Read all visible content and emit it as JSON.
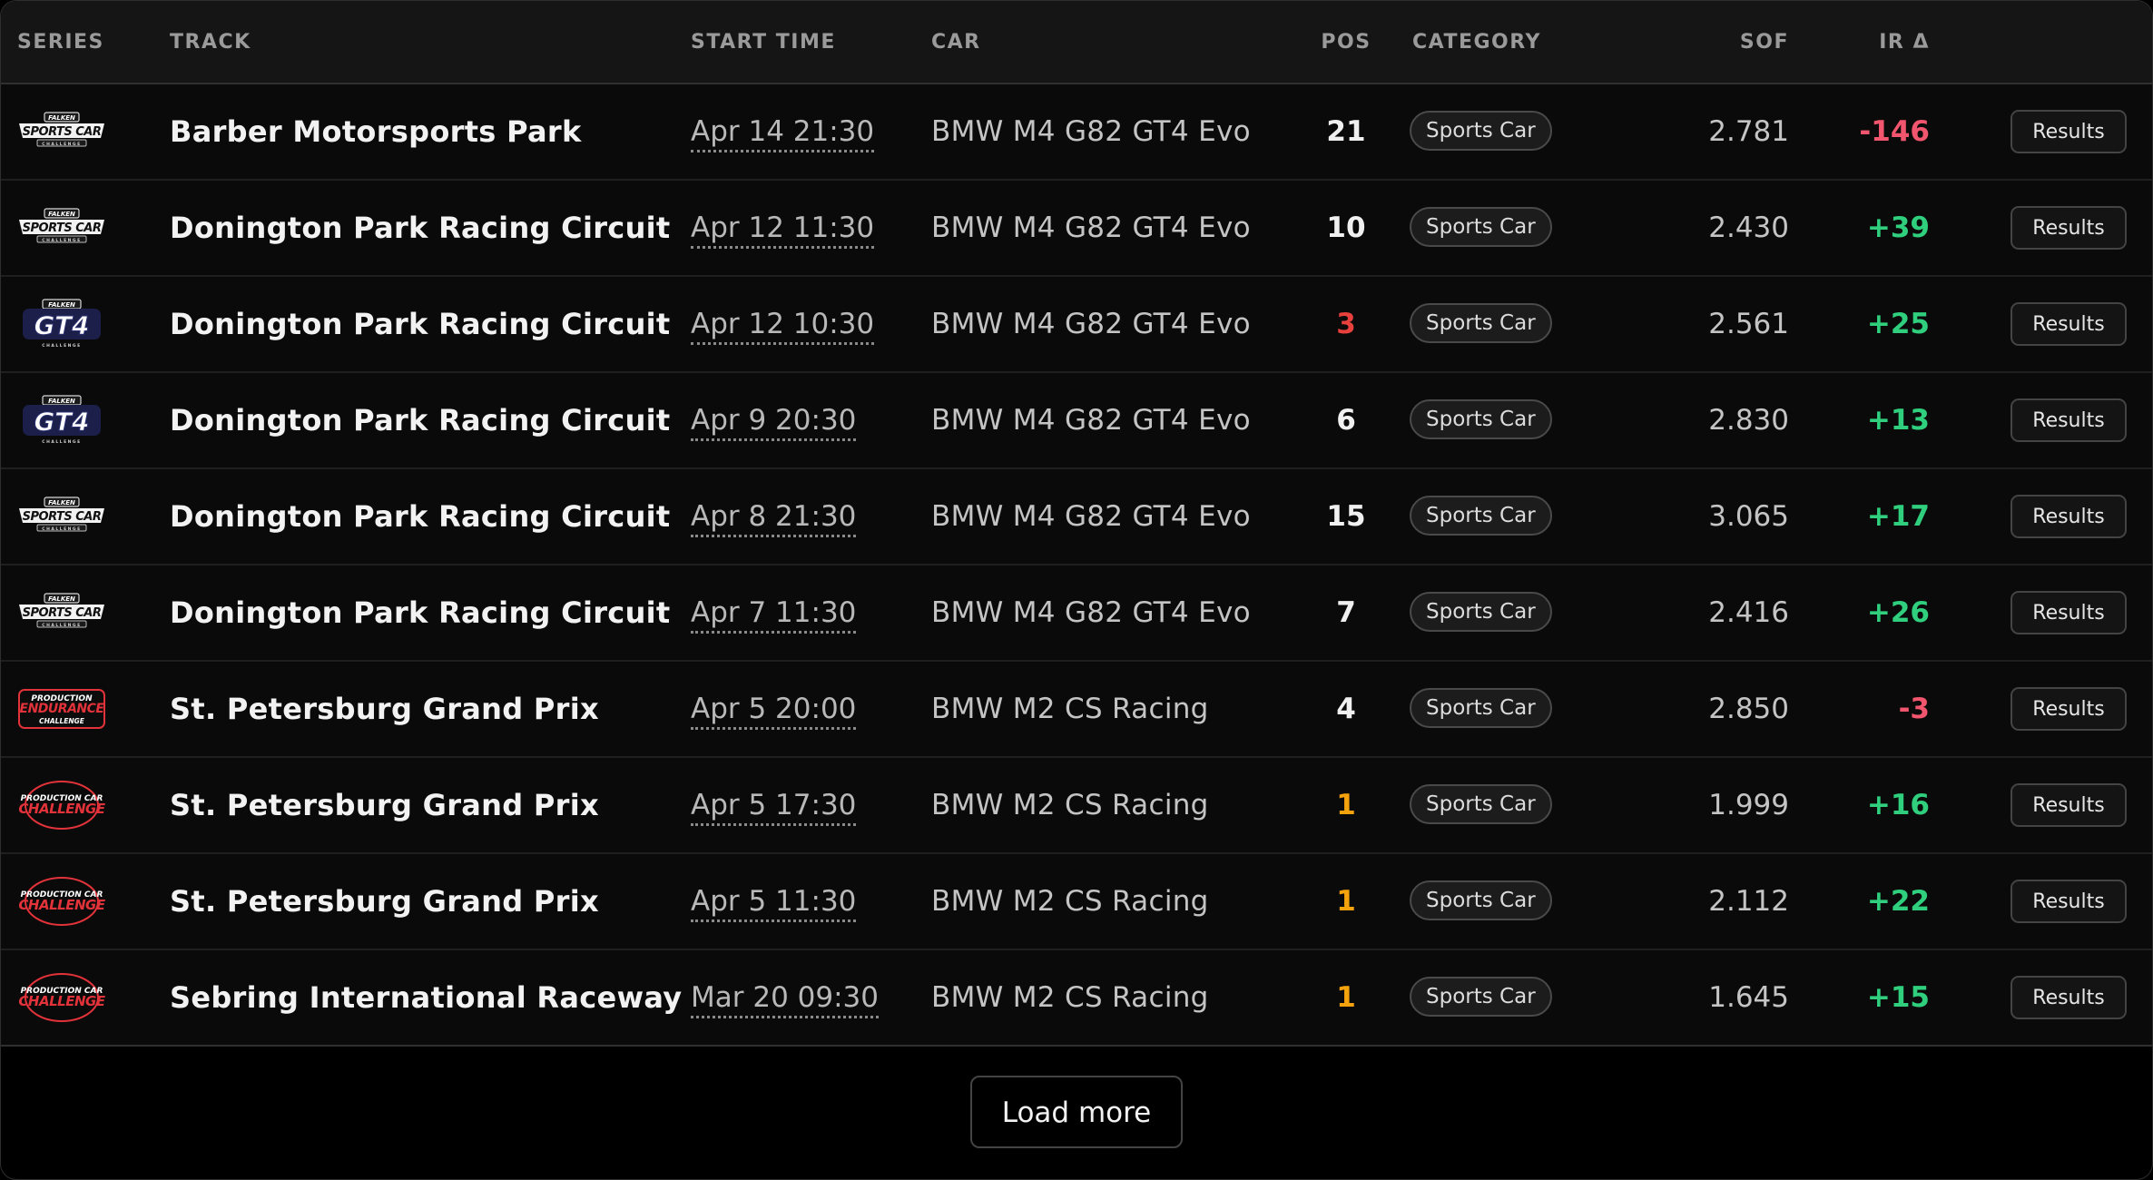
{
  "columns": {
    "series": "SERIES",
    "track": "TRACK",
    "start_time": "START TIME",
    "car": "CAR",
    "pos": "POS",
    "category": "CATEGORY",
    "sof": "SOF",
    "ir_delta": "IR Δ"
  },
  "colors": {
    "positive": "#2fcf7e",
    "negative": "#f2566e",
    "win": "#f4a30c",
    "podium": "#e8413d"
  },
  "rows": [
    {
      "series": {
        "logo": "sports-car-challenge-logo",
        "top": "FALKEN",
        "main": "SPORTS CAR",
        "sub": "CHALLENGE"
      },
      "track": "Barber Motorsports Park",
      "start_time": "Apr 14 21:30",
      "car": "BMW M4 G82 GT4 Evo",
      "pos": "21",
      "category": "Sports Car",
      "sof": "2.781",
      "ir_delta": "-146",
      "results": "Results"
    },
    {
      "series": {
        "logo": "sports-car-challenge-logo",
        "top": "FALKEN",
        "main": "SPORTS CAR",
        "sub": "CHALLENGE"
      },
      "track": "Donington Park Racing Circuit",
      "start_time": "Apr 12 11:30",
      "car": "BMW M4 G82 GT4 Evo",
      "pos": "10",
      "category": "Sports Car",
      "sof": "2.430",
      "ir_delta": "+39",
      "results": "Results"
    },
    {
      "series": {
        "logo": "gt4-challenge-logo",
        "top": "FALKEN",
        "main": "GT4",
        "sub": "CHALLENGE"
      },
      "track": "Donington Park Racing Circuit",
      "start_time": "Apr 12 10:30",
      "car": "BMW M4 G82 GT4 Evo",
      "pos": "3",
      "category": "Sports Car",
      "sof": "2.561",
      "ir_delta": "+25",
      "results": "Results"
    },
    {
      "series": {
        "logo": "gt4-challenge-logo",
        "top": "FALKEN",
        "main": "GT4",
        "sub": "CHALLENGE"
      },
      "track": "Donington Park Racing Circuit",
      "start_time": "Apr 9 20:30",
      "car": "BMW M4 G82 GT4 Evo",
      "pos": "6",
      "category": "Sports Car",
      "sof": "2.830",
      "ir_delta": "+13",
      "results": "Results"
    },
    {
      "series": {
        "logo": "sports-car-challenge-logo",
        "top": "FALKEN",
        "main": "SPORTS CAR",
        "sub": "CHALLENGE"
      },
      "track": "Donington Park Racing Circuit",
      "start_time": "Apr 8 21:30",
      "car": "BMW M4 G82 GT4 Evo",
      "pos": "15",
      "category": "Sports Car",
      "sof": "3.065",
      "ir_delta": "+17",
      "results": "Results"
    },
    {
      "series": {
        "logo": "sports-car-challenge-logo",
        "top": "FALKEN",
        "main": "SPORTS CAR",
        "sub": "CHALLENGE"
      },
      "track": "Donington Park Racing Circuit",
      "start_time": "Apr 7 11:30",
      "car": "BMW M4 G82 GT4 Evo",
      "pos": "7",
      "category": "Sports Car",
      "sof": "2.416",
      "ir_delta": "+26",
      "results": "Results"
    },
    {
      "series": {
        "logo": "production-endurance-challenge-logo",
        "top": "PRODUCTION",
        "main": "ENDURANCE",
        "sub": "CHALLENGE"
      },
      "track": "St. Petersburg Grand Prix",
      "start_time": "Apr 5 20:00",
      "car": "BMW M2 CS Racing",
      "pos": "4",
      "category": "Sports Car",
      "sof": "2.850",
      "ir_delta": "-3",
      "results": "Results"
    },
    {
      "series": {
        "logo": "production-car-challenge-logo",
        "top": "PRODUCTION CAR",
        "main": "CHALLENGE",
        "sub": ""
      },
      "track": "St. Petersburg Grand Prix",
      "start_time": "Apr 5 17:30",
      "car": "BMW M2 CS Racing",
      "pos": "1",
      "category": "Sports Car",
      "sof": "1.999",
      "ir_delta": "+16",
      "results": "Results"
    },
    {
      "series": {
        "logo": "production-car-challenge-logo",
        "top": "PRODUCTION CAR",
        "main": "CHALLENGE",
        "sub": ""
      },
      "track": "St. Petersburg Grand Prix",
      "start_time": "Apr 5 11:30",
      "car": "BMW M2 CS Racing",
      "pos": "1",
      "category": "Sports Car",
      "sof": "2.112",
      "ir_delta": "+22",
      "results": "Results"
    },
    {
      "series": {
        "logo": "production-car-challenge-logo",
        "top": "PRODUCTION CAR",
        "main": "CHALLENGE",
        "sub": ""
      },
      "track": "Sebring International Raceway",
      "start_time": "Mar 20 09:30",
      "car": "BMW M2 CS Racing",
      "pos": "1",
      "category": "Sports Car",
      "sof": "1.645",
      "ir_delta": "+15",
      "results": "Results"
    }
  ],
  "footer": {
    "load_more": "Load more"
  }
}
